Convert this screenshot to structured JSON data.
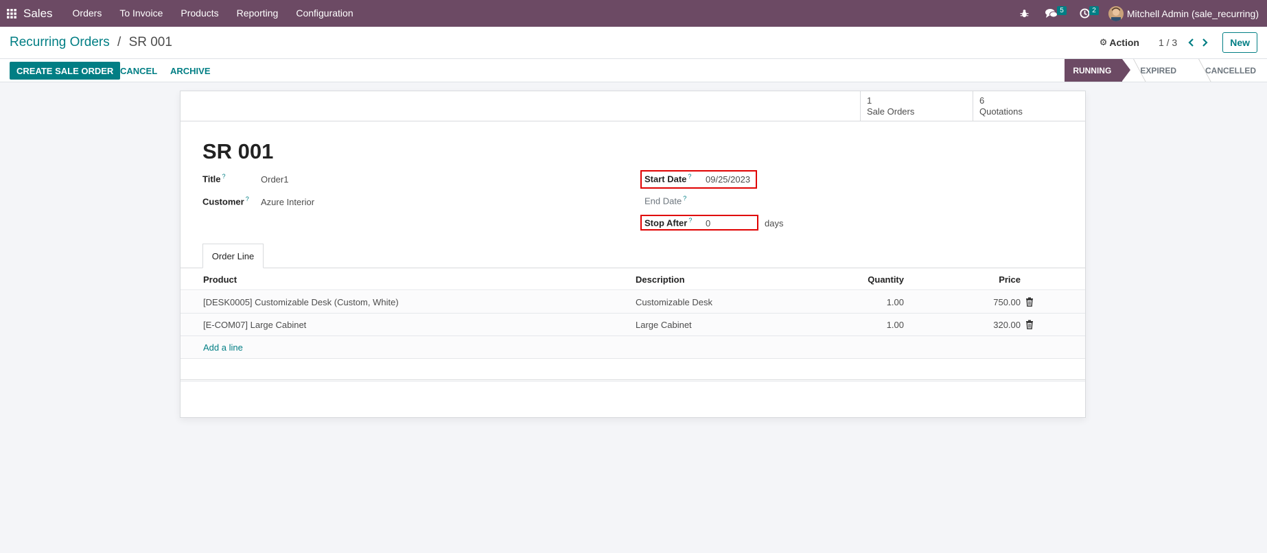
{
  "navbar": {
    "app_name": "Sales",
    "menu": [
      "Orders",
      "To Invoice",
      "Products",
      "Reporting",
      "Configuration"
    ],
    "messages_count": "5",
    "activities_count": "2",
    "user": "Mitchell Admin (sale_recurring)"
  },
  "breadcrumb": {
    "parent": "Recurring Orders",
    "separator": "/",
    "current": "SR 001"
  },
  "control_panel": {
    "action_label": "Action",
    "pager": "1 / 3",
    "new_label": "New"
  },
  "statusbar": {
    "buttons": [
      "CREATE SALE ORDER",
      "CANCEL",
      "ARCHIVE"
    ],
    "stages": [
      "RUNNING",
      "EXPIRED",
      "CANCELLED"
    ],
    "active_stage": "RUNNING"
  },
  "smart_buttons": [
    {
      "count": "1",
      "label": "Sale Orders"
    },
    {
      "count": "6",
      "label": "Quotations"
    }
  ],
  "record": {
    "name": "SR 001",
    "title_label": "Title",
    "title_value": "Order1",
    "customer_label": "Customer",
    "customer_value": "Azure Interior",
    "start_date_label": "Start Date",
    "start_date_value": "09/25/2023",
    "end_date_label": "End Date",
    "end_date_value": "",
    "stop_after_label": "Stop After",
    "stop_after_value": "0",
    "stop_after_unit": "days",
    "help_mark": "?"
  },
  "tabs": [
    "Order Line"
  ],
  "order_lines": {
    "headers": {
      "product": "Product",
      "description": "Description",
      "quantity": "Quantity",
      "price": "Price"
    },
    "rows": [
      {
        "product": "[DESK0005] Customizable Desk (Custom, White)",
        "description": "Customizable Desk",
        "quantity": "1.00",
        "price": "750.00"
      },
      {
        "product": "[E-COM07] Large Cabinet",
        "description": "Large Cabinet",
        "quantity": "1.00",
        "price": "320.00"
      }
    ],
    "add_line": "Add a line"
  },
  "colors": {
    "navbar": "#6c4a64",
    "accent": "#017e84",
    "highlight": "#e00000"
  }
}
